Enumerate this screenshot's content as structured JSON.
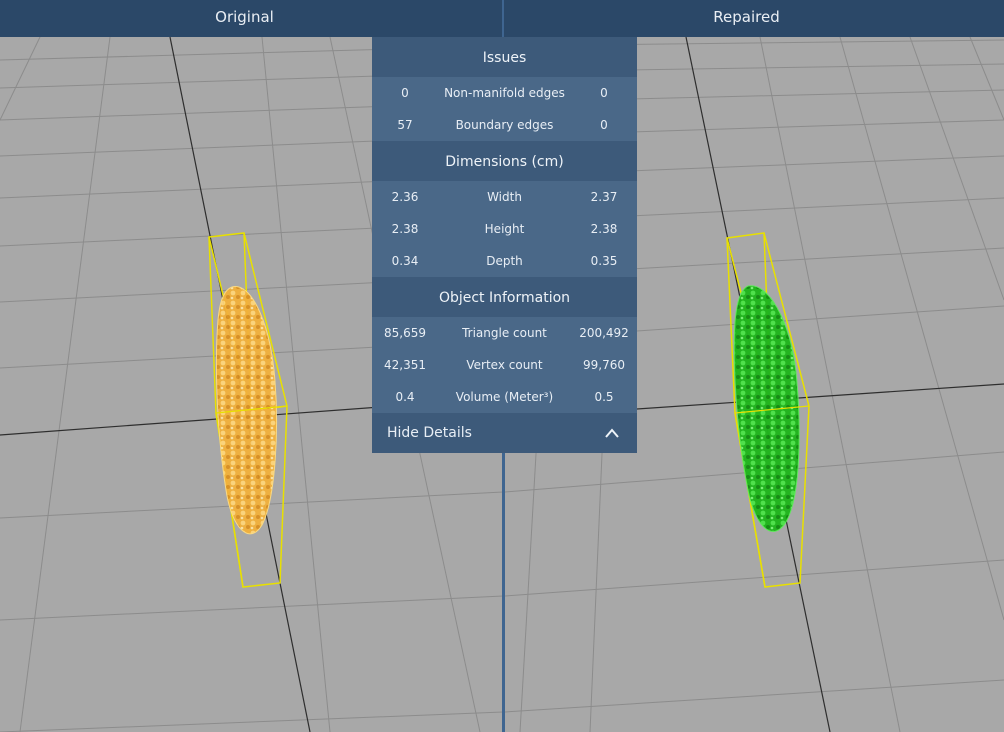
{
  "header": {
    "left_title": "Original",
    "right_title": "Repaired"
  },
  "details": {
    "issues": {
      "title": "Issues",
      "rows": [
        {
          "original": "0",
          "label": "Non-manifold edges",
          "repaired": "0"
        },
        {
          "original": "57",
          "label": "Boundary edges",
          "repaired": "0"
        }
      ]
    },
    "dimensions": {
      "title": "Dimensions (cm)",
      "rows": [
        {
          "original": "2.36",
          "label": "Width",
          "repaired": "2.37"
        },
        {
          "original": "2.38",
          "label": "Height",
          "repaired": "2.38"
        },
        {
          "original": "0.34",
          "label": "Depth",
          "repaired": "0.35"
        }
      ]
    },
    "object_info": {
      "title": "Object Information",
      "rows": [
        {
          "original": "85,659",
          "label": "Triangle count",
          "repaired": "200,492"
        },
        {
          "original": "42,351",
          "label": "Vertex count",
          "repaired": "99,760"
        },
        {
          "original": "0.4",
          "label": "Volume (Meter³)",
          "repaired": "0.5"
        }
      ]
    },
    "toggle_label": "Hide Details",
    "toggle_icon": "chevron-up-icon"
  },
  "colors": {
    "header_bg": "#2b4868",
    "section_bg": "#3d5a7a",
    "row_bg": "#4a6888",
    "bbox": "#e8e000",
    "original_model": "#f0b43a",
    "repaired_model": "#22c41f",
    "divider": "#3f6590"
  }
}
